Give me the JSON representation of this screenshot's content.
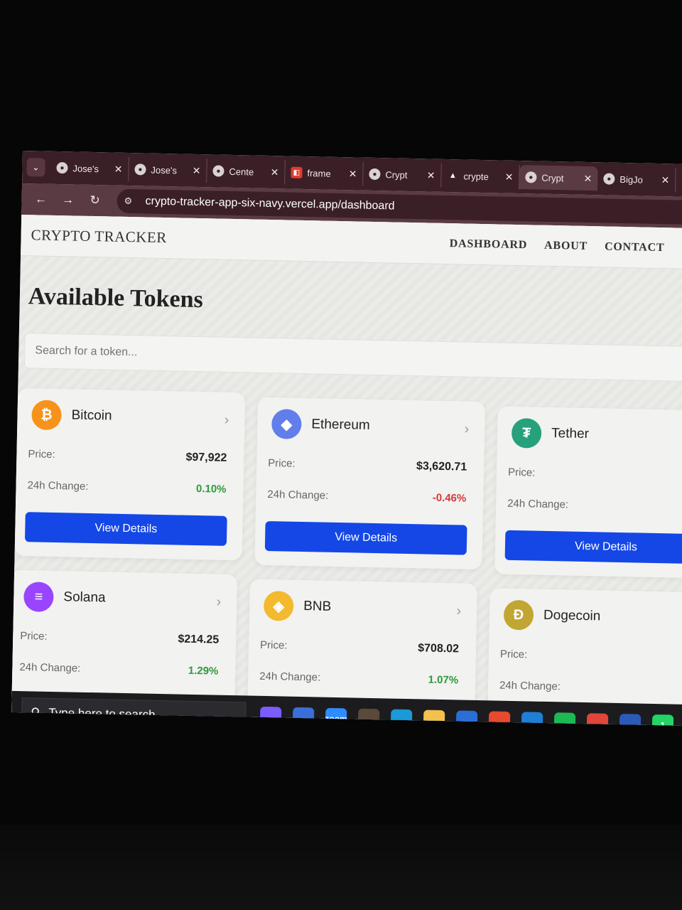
{
  "browser": {
    "tabs": [
      {
        "label": "Jose's",
        "icon": "globe-icon"
      },
      {
        "label": "Jose's",
        "icon": "globe-icon"
      },
      {
        "label": "Cente",
        "icon": "openai-icon"
      },
      {
        "label": "frame",
        "icon": "framer-icon"
      },
      {
        "label": "Crypt",
        "icon": "globe-icon"
      },
      {
        "label": "crypte",
        "icon": "vercel-icon"
      },
      {
        "label": "Crypt",
        "icon": "globe-icon"
      },
      {
        "label": "BigJo",
        "icon": "github-icon"
      }
    ],
    "url": "crypto-tracker-app-six-navy.vercel.app/dashboard"
  },
  "site": {
    "brand": "CRYPTO TRACKER",
    "nav": [
      "DASHBOARD",
      "ABOUT",
      "CONTACT"
    ],
    "title": "Available Tokens",
    "search_placeholder": "Search for a token..."
  },
  "labels": {
    "price": "Price:",
    "change": "24h Change:",
    "button": "View Details"
  },
  "tokens": [
    {
      "name": "Bitcoin",
      "price": "$97,922",
      "change": "0.10%",
      "trend": "up",
      "color": "#f7931a",
      "icon": "bitcoin-icon",
      "glyph": "₿"
    },
    {
      "name": "Ethereum",
      "price": "$3,620.71",
      "change": "-0.46%",
      "trend": "down",
      "color": "#627eea",
      "icon": "ethereum-icon",
      "glyph": "◆"
    },
    {
      "name": "Tether",
      "price": "",
      "change": "",
      "trend": "none",
      "color": "#26a17b",
      "icon": "tether-icon",
      "glyph": "₮"
    },
    {
      "name": "Solana",
      "price": "$214.25",
      "change": "1.29%",
      "trend": "up",
      "color": "#9945ff",
      "icon": "solana-icon",
      "glyph": "≡"
    },
    {
      "name": "BNB",
      "price": "$708.02",
      "change": "1.07%",
      "trend": "up",
      "color": "#f3ba2f",
      "icon": "bnb-icon",
      "glyph": "◈"
    },
    {
      "name": "Dogecoin",
      "price": "$",
      "change": "",
      "trend": "none",
      "color": "#c2a633",
      "icon": "dogecoin-icon",
      "glyph": "Ð"
    }
  ],
  "taskbar": {
    "search_text": "Type here to search",
    "apps": [
      {
        "icon": "copilot-icon",
        "color": "#7b5cff"
      },
      {
        "icon": "store-icon",
        "color": "#3a6fd8"
      },
      {
        "icon": "zoom-icon",
        "color": "#2d8cff",
        "label": "zoom"
      },
      {
        "icon": "game-icon",
        "color": "#5a4a3a"
      },
      {
        "icon": "edge-icon",
        "color": "#1a9ad6"
      },
      {
        "icon": "folder-icon",
        "color": "#f2c14e"
      },
      {
        "icon": "powershell-icon",
        "color": "#2a6ed8"
      },
      {
        "icon": "git-icon",
        "color": "#e8492f"
      },
      {
        "icon": "vscode-icon",
        "color": "#1f7fd6"
      },
      {
        "icon": "spotify-icon",
        "color": "#1db954"
      },
      {
        "icon": "chrome-icon",
        "color": "#e0463a"
      },
      {
        "icon": "word-icon",
        "color": "#2b5bb8"
      },
      {
        "icon": "whatsapp-icon",
        "color": "#25d366",
        "badge": "1"
      }
    ]
  }
}
